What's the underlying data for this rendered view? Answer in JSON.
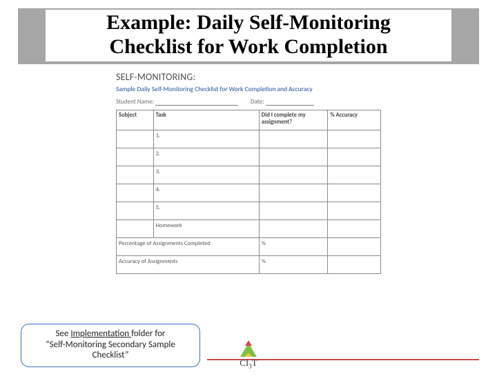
{
  "slide": {
    "title_line1": "Example: Daily Self-Monitoring",
    "title_line2": "Checklist for Work Completion"
  },
  "sheet": {
    "heading": "SELF-MONITORING:",
    "subtitle": "Sample Daily Self-Monitoring Checklist for Work Completion and Accuracy",
    "student_label": "Student Name:",
    "date_label": "Date:",
    "cols": {
      "subject": "Subject",
      "task": "Task",
      "did": "Did I complete my assignment?",
      "accuracy": "% Accuracy"
    },
    "rows": [
      "1.",
      "2.",
      "3.",
      "4.",
      "5."
    ],
    "hw_label": "Homework",
    "pct_row": "Percentage of Assignments Completed",
    "acc_row": "Accuracy of Assignments",
    "pct_symbol": "%"
  },
  "callout": {
    "line1a": "See ",
    "line1b": "Implementation ",
    "line1c": "folder for",
    "line2": "“Self-Monitoring Secondary Sample",
    "line3": "Checklist”"
  },
  "footer": {
    "logo_text_a": "CI",
    "logo_text_b": "3",
    "logo_text_c": "T"
  }
}
